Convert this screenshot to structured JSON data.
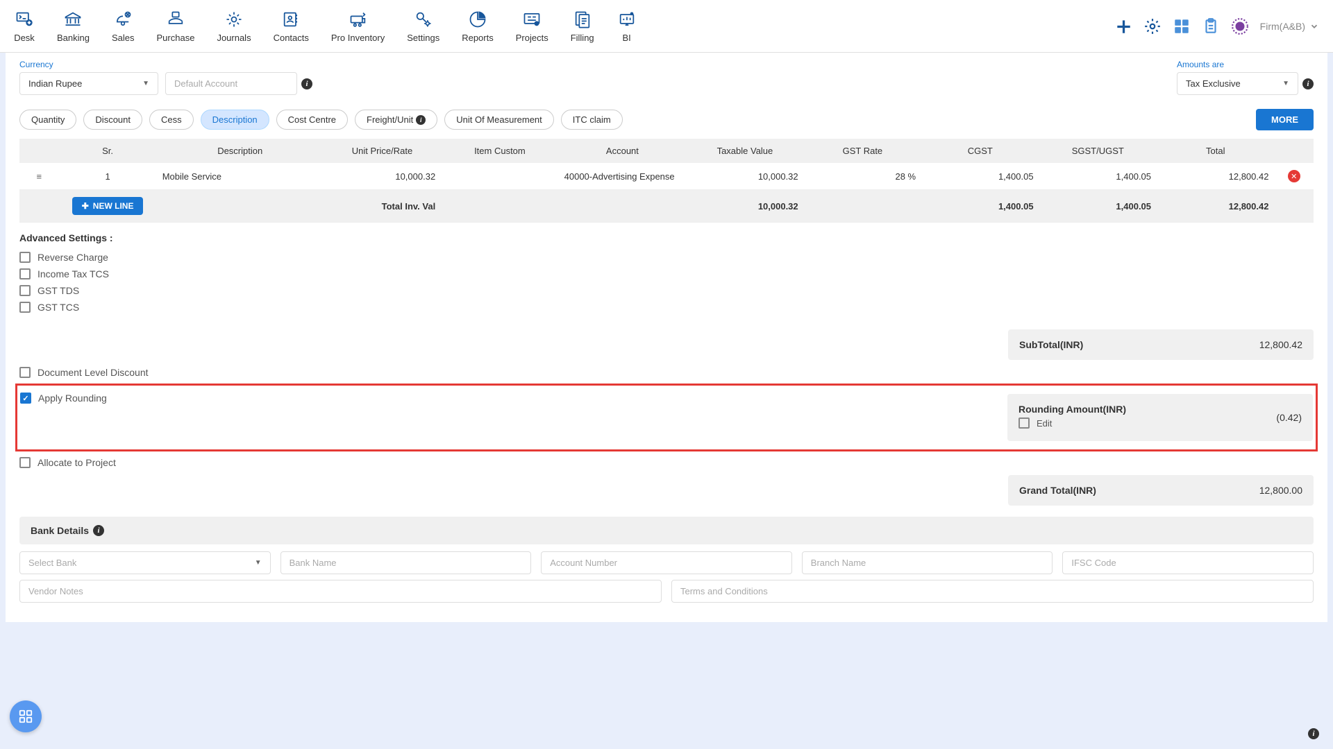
{
  "nav": {
    "items": [
      "Desk",
      "Banking",
      "Sales",
      "Purchase",
      "Journals",
      "Contacts",
      "Pro Inventory",
      "Settings",
      "Reports",
      "Projects",
      "Filling",
      "BI"
    ]
  },
  "firm": "Firm(A&B)",
  "currency": {
    "label": "Currency",
    "value": "Indian Rupee"
  },
  "default_account_placeholder": "Default Account",
  "amounts": {
    "label": "Amounts are",
    "value": "Tax Exclusive"
  },
  "chips": [
    "Quantity",
    "Discount",
    "Cess",
    "Description",
    "Cost Centre",
    "Freight/Unit",
    "Unit Of Measurement",
    "ITC claim"
  ],
  "more": "MORE",
  "headers": {
    "sr": "Sr.",
    "desc": "Description",
    "unit": "Unit Price/Rate",
    "item": "Item Custom",
    "account": "Account",
    "taxable": "Taxable Value",
    "gst": "GST Rate",
    "cgst": "CGST",
    "sgst": "SGST/UGST",
    "total": "Total"
  },
  "row": {
    "sr": "1",
    "desc": "Mobile Service",
    "unit": "10,000.32",
    "item": "",
    "account": "40000-Advertising Expense",
    "taxable": "10,000.32",
    "gst": "28 %",
    "cgst": "1,400.05",
    "sgst": "1,400.05",
    "total": "12,800.42"
  },
  "totals": {
    "label": "Total Inv. Val",
    "taxable": "10,000.32",
    "cgst": "1,400.05",
    "sgst": "1,400.05",
    "total": "12,800.42"
  },
  "new_line": "NEW LINE",
  "adv": {
    "title": "Advanced Settings :",
    "reverse": "Reverse Charge",
    "tcs": "Income Tax TCS",
    "gsttds": "GST TDS",
    "gsttcs": "GST TCS",
    "doc_disc": "Document Level Discount",
    "apply_round": "Apply Rounding",
    "allocate": "Allocate to Project"
  },
  "summary": {
    "sub_label": "SubTotal(INR)",
    "sub_val": "12,800.42",
    "round_label": "Rounding Amount(INR)",
    "round_edit": "Edit",
    "round_val": "(0.42)",
    "grand_label": "Grand Total(INR)",
    "grand_val": "12,800.00"
  },
  "bank": {
    "header": "Bank Details",
    "select": "Select Bank",
    "name": "Bank Name",
    "acct": "Account Number",
    "branch": "Branch Name",
    "ifsc": "IFSC Code"
  },
  "notes": {
    "vendor": "Vendor Notes",
    "terms": "Terms and Conditions"
  }
}
